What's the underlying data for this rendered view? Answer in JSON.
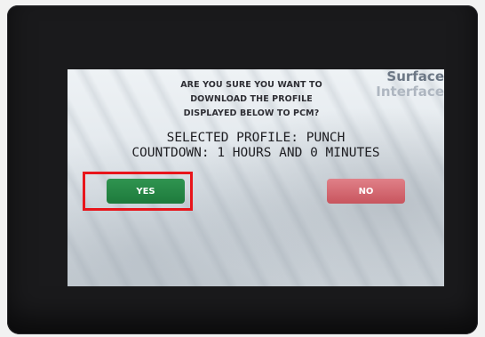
{
  "dialog": {
    "prompt_lines": [
      "ARE YOU SURE YOU WANT TO",
      "DOWNLOAD THE PROFILE",
      "DISPLAYED BELOW TO PCM?"
    ],
    "brand_line1": "Surface",
    "brand_line2": "Interface",
    "selected_profile": "SELECTED PROFILE: PUNCH",
    "countdown": "COUNTDOWN: 1 HOURS AND 0 MINUTES",
    "yes_label": "YES",
    "no_label": "NO"
  },
  "colors": {
    "yes_button": "#1e7a3c",
    "no_button": "#c8555e",
    "highlight_box": "#e8151b"
  }
}
